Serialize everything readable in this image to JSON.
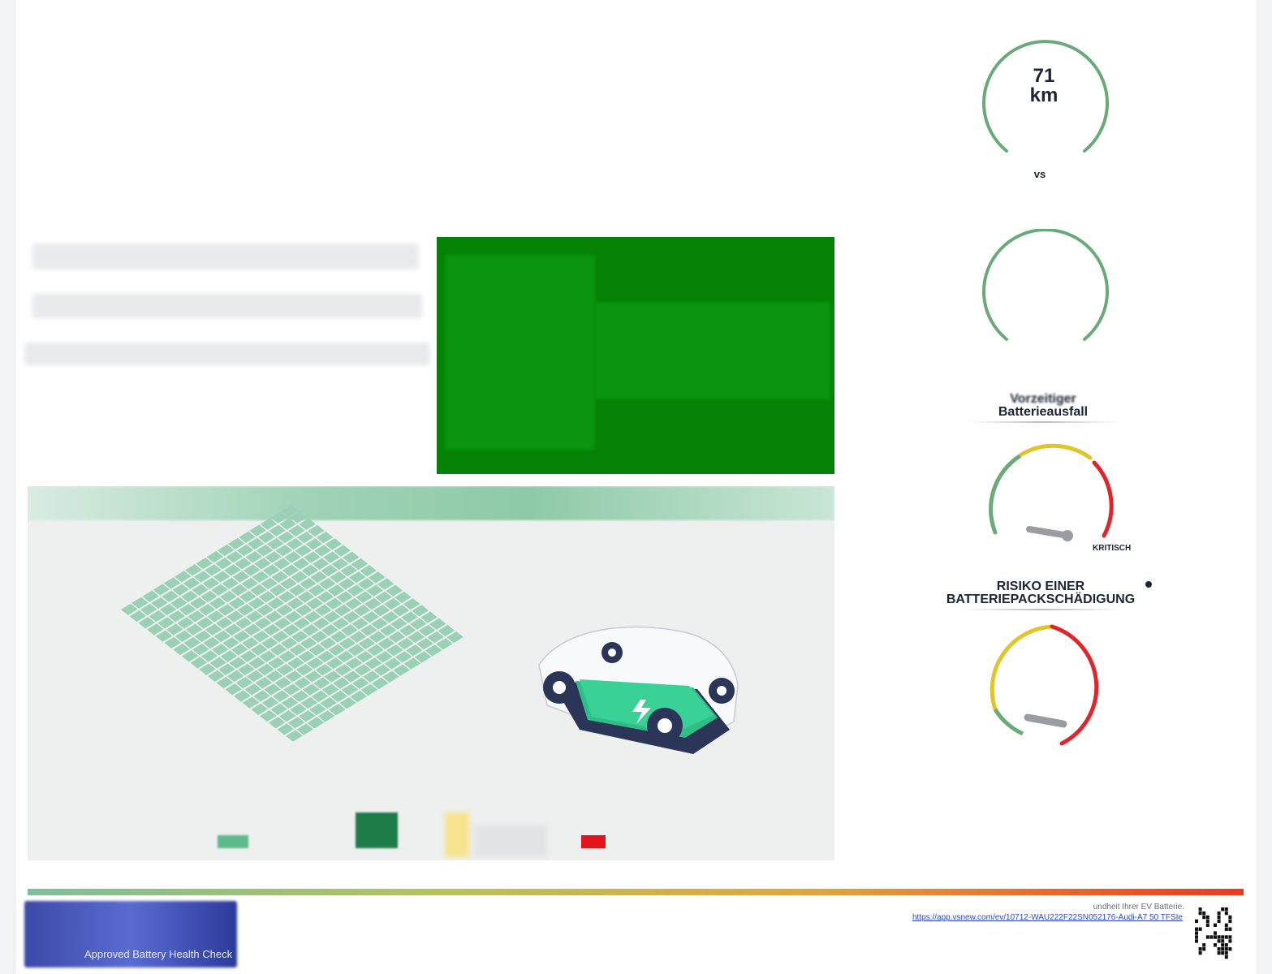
{
  "range_gauge": {
    "value": "71",
    "unit": "km",
    "vs": "vs"
  },
  "premature_failure": {
    "title_line1": "Vorzeitiger",
    "title_line2": "Batterieausfall",
    "critical": "KRITISCH"
  },
  "pack_damage": {
    "title_line1": "RISIKO EINER",
    "title_line2": "BATTERIEPACKSCHÄDIGUNG",
    "info_icon": "info-icon"
  },
  "footer": {
    "logo_text": "Approved Battery Health Check",
    "note": "undheit Ihrer EV Batterie.",
    "link": "https://app.vsnew.com/ev/10712-WAU222F22SN052176-Audi-A7 50 TFSIe"
  },
  "colors": {
    "green_card": "#058205",
    "gauge_green": "#6aaa78",
    "gauge_yellow": "#e2c428",
    "gauge_red": "#e0262a"
  }
}
